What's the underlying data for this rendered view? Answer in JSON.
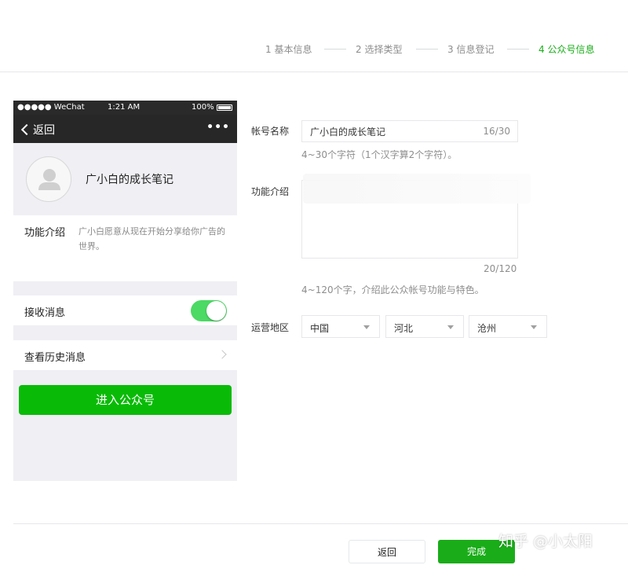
{
  "stepper": {
    "steps": [
      {
        "label": "1 基本信息"
      },
      {
        "label": "2 选择类型"
      },
      {
        "label": "3 信息登记"
      },
      {
        "label": "4 公众号信息"
      }
    ]
  },
  "phone": {
    "status": {
      "carrier": "●●●●● WeChat",
      "time": "1:21 AM",
      "battery": "100%"
    },
    "nav": {
      "back": "返回",
      "more": "•••"
    },
    "profile_name": "广小白的成长笔记",
    "intro_label": "功能介绍",
    "intro_text": "广小白愿意从现在开始分享给你广告的世界。",
    "receive_label": "接收消息",
    "receive_on": true,
    "history_label": "查看历史消息",
    "enter_label": "进入公众号"
  },
  "form": {
    "name_label": "帐号名称",
    "name_value": "广小白的成长笔记",
    "name_counter": "16/30",
    "name_hint": "4~30个字符（1个汉字算2个字符）。",
    "intro_label": "功能介绍",
    "intro_value": "",
    "intro_counter": "20/120",
    "intro_hint": "4~120个字，介绍此公众帐号功能与特色。",
    "region_label": "运营地区",
    "country": "中国",
    "province": "河北",
    "city": "沧州"
  },
  "footer": {
    "back": "返回",
    "done": "完成"
  },
  "watermark": "知乎 @小太阳",
  "colors": {
    "accent": "#1aad19",
    "toggle": "#4cd964",
    "enter": "#09bb07"
  }
}
